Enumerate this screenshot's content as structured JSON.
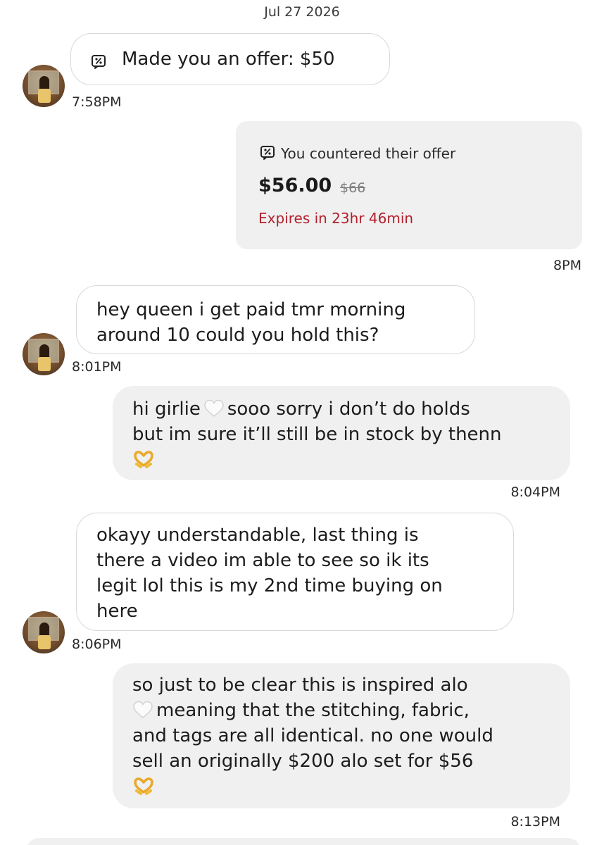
{
  "date_header": "Jul 27 2026",
  "messages": [
    {
      "id": "m1",
      "text": "Made you an offer: $50",
      "time": "7:58PM"
    },
    {
      "id": "m2",
      "heading": "You countered their offer",
      "price": "$56.00",
      "original_price": "$66",
      "expiry": "Expires in 23hr 46min",
      "time": "8PM"
    },
    {
      "id": "m3",
      "lines": [
        "hey queen i get paid tmr morning",
        "around 10 could you hold this?"
      ],
      "time": "8:01PM"
    },
    {
      "id": "m4",
      "line1_a": "hi girlie",
      "line1_b": "sooo sorry i don’t do holds",
      "line2": "but im sure it’ll still be in stock by thenn",
      "time": "8:04PM"
    },
    {
      "id": "m5",
      "lines": [
        "okayy understandable, last thing is",
        "there a video im able to see so ik its",
        "legit lol this is my 2nd time buying on",
        "here"
      ],
      "time": "8:06PM"
    },
    {
      "id": "m6",
      "line1": "so just to be clear this is inspired alo",
      "line2_b": "meaning that the stitching, fabric,",
      "line3": "and tags are all identical. no one would",
      "line4": "sell an originally $200 alo set for $56",
      "time": "8:13PM"
    }
  ],
  "icons": {
    "offer_tag": "discount-tag-icon",
    "white_heart": "white-heart-emoji",
    "heart_hands": "heart-hands-emoji",
    "avatar": "user-avatar-photo"
  },
  "colors": {
    "outgoing_bubble": "#f0f0f0",
    "incoming_border": "#d9d9d9",
    "expiry_text": "#b3202c"
  }
}
